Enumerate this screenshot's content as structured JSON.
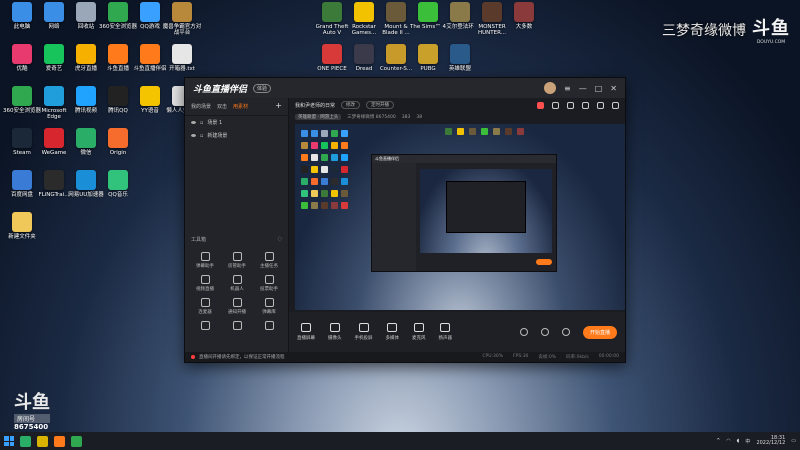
{
  "watermark": {
    "top_right_text": "三梦奇缘微博",
    "logo_big": "斗鱼",
    "logo_small": "DOUYU.COM",
    "bottom_left_room_label": "房间号",
    "bottom_left_room_number": "8675400"
  },
  "desktop": {
    "icons": [
      {
        "label": "此电脑",
        "color": "#3a8ee6"
      },
      {
        "label": "网络",
        "color": "#3a8ee6"
      },
      {
        "label": "回收站",
        "color": "#9aa7b8"
      },
      {
        "label": "360安全浏览器",
        "color": "#2fa84f"
      },
      {
        "label": "QQ游戏",
        "color": "#3aa0ff"
      },
      {
        "label": "魔兽争霸官方对战平台",
        "color": "#b8893a"
      },
      {
        "label": "优酷",
        "color": "#e83a6e"
      },
      {
        "label": "爱奇艺",
        "color": "#16c45b"
      },
      {
        "label": "虎牙直播",
        "color": "#f5b000"
      },
      {
        "label": "斗鱼直播",
        "color": "#ff7a1a"
      },
      {
        "label": "斗鱼直播伴侣",
        "color": "#ff7a1a"
      },
      {
        "label": "开箱器.txt",
        "color": "#e6e6e6"
      },
      {
        "label": "360安全浏览器",
        "color": "#2fa84f"
      },
      {
        "label": "Microsoft Edge",
        "color": "#1f9edb"
      },
      {
        "label": "腾讯视频",
        "color": "#1fa3ff"
      },
      {
        "label": "腾讯QQ",
        "color": "#222222"
      },
      {
        "label": "YY语音",
        "color": "#f5c400"
      },
      {
        "label": "懒人人生.txt",
        "color": "#e6e6e6"
      },
      {
        "label": "Steam",
        "color": "#1b2838"
      },
      {
        "label": "WeGame",
        "color": "#d8262f"
      },
      {
        "label": "微信",
        "color": "#2aae67"
      },
      {
        "label": "Origin",
        "color": "#f56c2d"
      },
      {
        "label": "百度网盘",
        "color": "#3a7bd5"
      },
      {
        "label": "FLiNGTrai...",
        "color": "#2b2b2b"
      },
      {
        "label": "网易UU加速器",
        "color": "#1a8fd8"
      },
      {
        "label": "QQ音乐",
        "color": "#31c27c"
      },
      {
        "label": "新建文件夹",
        "color": "#f0c85a"
      }
    ],
    "top_icons": [
      {
        "label": "Grand Theft Auto V",
        "color": "#3c7a3a"
      },
      {
        "label": "Rockstar Games...",
        "color": "#f2c200"
      },
      {
        "label": "Mount & Blade II ...",
        "color": "#6b5a3a"
      },
      {
        "label": "The Sims™ 4",
        "color": "#3bbf3b"
      },
      {
        "label": "艾尔登法环",
        "color": "#8a7a4a"
      },
      {
        "label": "MONSTER HUNTER...",
        "color": "#5a3a2a"
      },
      {
        "label": "大多数",
        "color": "#8a3a3a"
      },
      {
        "label": "ONE PIECE",
        "color": "#d83a3a"
      },
      {
        "label": "Dread",
        "color": "#3a3a4a"
      },
      {
        "label": "Counter-S...",
        "color": "#c89a2a"
      },
      {
        "label": "PUBG",
        "color": "#c8a02a"
      },
      {
        "label": "英雄联盟",
        "color": "#2a5a8a"
      }
    ]
  },
  "app": {
    "logo": "斗鱼直播伴侣",
    "badge": "体验",
    "tabs": [
      "我的场景",
      "双击",
      "用素材"
    ],
    "scenes": [
      "场景 1",
      "新建场景"
    ],
    "tools_title": "工具箱",
    "tools": [
      "弹幕助手",
      "房管助手",
      "主播任务",
      "视频直播",
      "机器人",
      "投票助手",
      "连麦器",
      "通知开播",
      "弹幕库",
      "",
      "",
      ""
    ],
    "main_title": "我和尹老师的日常",
    "edit_label": "修改",
    "schedule_label": "定时开播",
    "info": [
      "英雄联盟 · 网游上头",
      "三梦奇缘微博 8675400",
      "383",
      "38"
    ],
    "bottom_tools": [
      "直播屏幕",
      "摄像头",
      "手机投屏",
      "多媒体",
      "麦克风",
      "扬声器"
    ],
    "start_button": "开始直播",
    "status_text": "直播间开播请先绑定，以保证正常开播流程",
    "status_right": [
      "CPU:30%",
      "FPS:30",
      "丢帧:0%",
      "码率:0kb/s",
      "00:00:00"
    ]
  },
  "taskbar": {
    "time": "18:31",
    "date": "2022/12/12",
    "apps": [
      "#2aae67",
      "#d8b400",
      "#ff7a1a",
      "#2fa84f"
    ]
  }
}
